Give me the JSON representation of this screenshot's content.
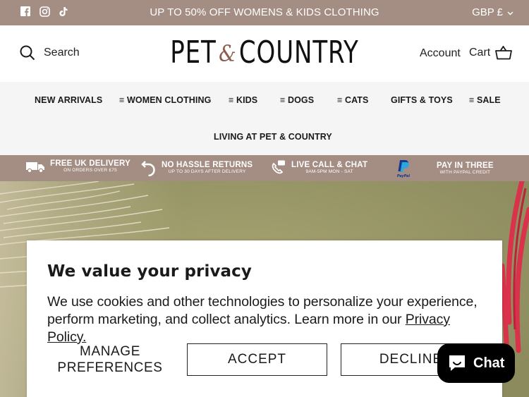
{
  "topbar": {
    "announcement": "UP TO 50% OFF WOMENS & KIDS CLOTHING",
    "currency": "GBP £",
    "social": [
      "facebook-icon",
      "instagram-icon",
      "tiktok-icon"
    ]
  },
  "header": {
    "search_label": "Search",
    "logo_left": "PET",
    "logo_amp": "&",
    "logo_right": "COUNTRY",
    "account_label": "Account",
    "cart_label": "Cart"
  },
  "nav": {
    "items": [
      {
        "label": "NEW ARRIVALS"
      },
      {
        "label": "≡ WOMEN CLOTHING"
      },
      {
        "label": "≡ KIDS"
      },
      {
        "label": "≡ DOGS"
      },
      {
        "label": "≡ CATS"
      },
      {
        "label": "GIFTS & TOYS"
      },
      {
        "label": "≡ SALE"
      },
      {
        "label": "LIVING AT PET & COUNTRY"
      }
    ]
  },
  "usp": {
    "items": [
      {
        "title": "FREE UK DELIVERY",
        "sub": "ON ORDERS OVER £75",
        "icon": "truck-icon"
      },
      {
        "title": "NO HASSLE RETURNS",
        "sub": "UP TO 30 DAYS AFTER DELIVERY",
        "icon": "return-arrow-icon"
      },
      {
        "title": "LIVE CALL & CHAT",
        "sub": "9AM-5PM MON - SAT",
        "icon": "phone-chat-icon"
      },
      {
        "title": "PAY IN THREE",
        "sub": "WITH PAYPAL CREDIT",
        "icon": "paypal-icon"
      }
    ]
  },
  "privacy": {
    "title": "We value your privacy",
    "body": "We use cookies and other technologies to personalize your experience, perform marketing, and collect analytics. Learn more in our",
    "link": "Privacy Policy.",
    "manage_line1": "MANAGE",
    "manage_line2": "PREFERENCES",
    "accept": "ACCEPT",
    "decline": "DECLINE"
  },
  "chat": {
    "label": "Chat",
    "icon": "chat-bubble-icon"
  },
  "colors": {
    "brand_taupe": "#a48d83",
    "nav_bg": "#f5f5f5",
    "hero_olive": "#9b9a6c",
    "chat_bg": "#000000"
  }
}
